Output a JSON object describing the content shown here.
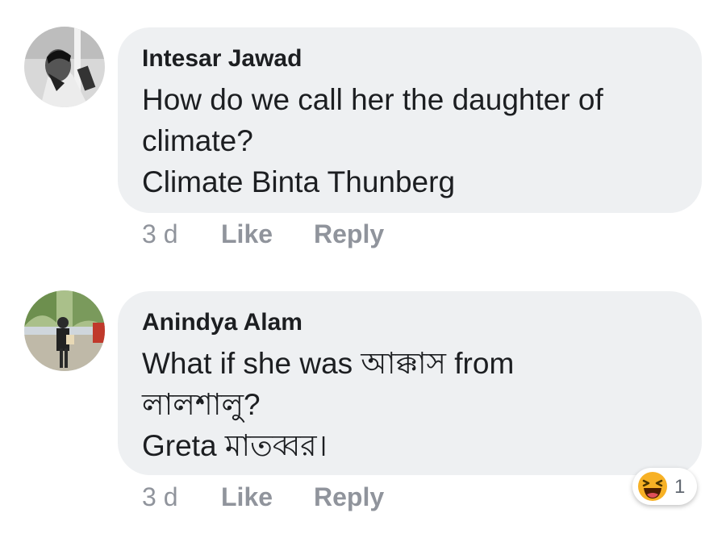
{
  "comments": [
    {
      "author": "Intesar Jawad",
      "lines": [
        "How do we call her the daughter of",
        "climate?",
        "Climate Binta Thunberg"
      ],
      "time": "3 d",
      "like_label": "Like",
      "reply_label": "Reply"
    },
    {
      "author": "Anindya Alam",
      "lines": [
        "What if she was আক্কাস from",
        "লালশালু?",
        "Greta মাতব্বর।"
      ],
      "time": "3 d",
      "like_label": "Like",
      "reply_label": "Reply",
      "reaction": {
        "icon": "haha-emoji-icon",
        "count": "1"
      }
    }
  ],
  "colors": {
    "bubble": "#eef0f2",
    "meta_text": "#90949c",
    "emoji": "#f7b125"
  }
}
